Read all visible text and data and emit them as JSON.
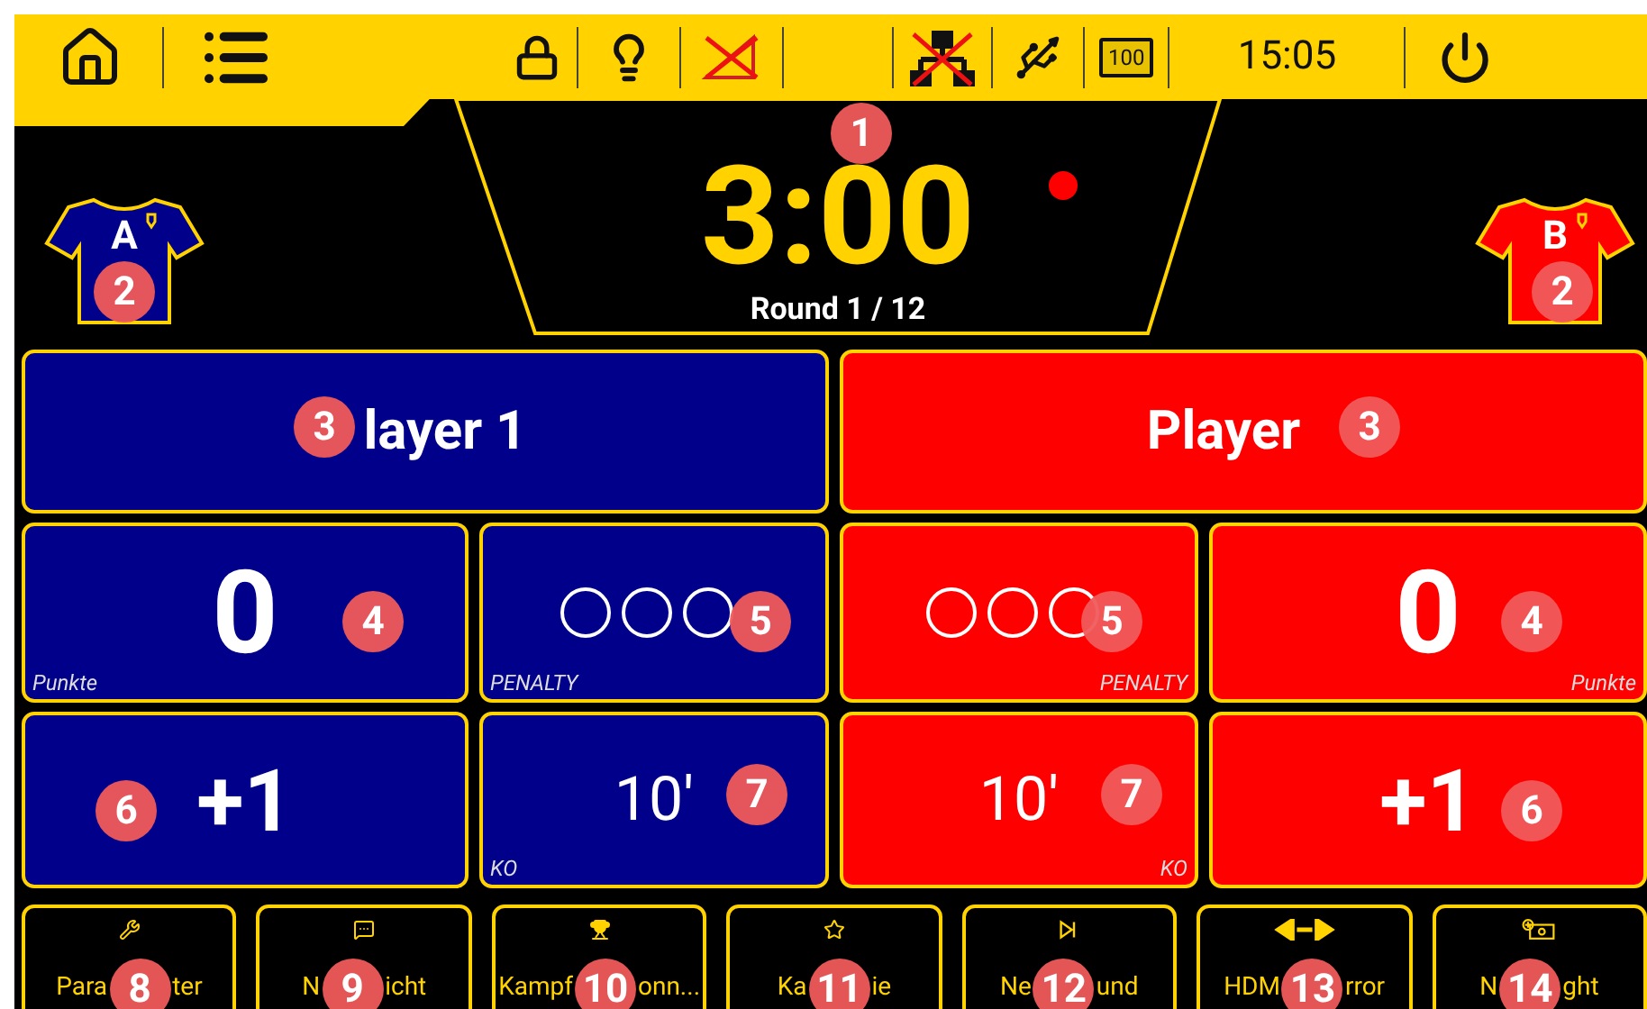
{
  "top_bar": {
    "time": "15:05",
    "battery": "100"
  },
  "timer": {
    "time": "3:00",
    "round": "Round 1 / 12",
    "running": true,
    "marker": "1"
  },
  "teams": [
    {
      "color": "#00008b",
      "letter": "A",
      "shirt_marker": "2",
      "name": "layer 1",
      "name_marker": "3",
      "score": "0",
      "score_label": "Punkte",
      "score_marker": "4",
      "penalties": [
        {
          "filled": false
        },
        {
          "filled": false
        },
        {
          "filled": false
        }
      ],
      "penalty_label": "PENALTY",
      "penalty_marker": "5",
      "add": "+1",
      "add_marker": "6",
      "ko": "10'",
      "ko_label": "KO",
      "ko_marker": "7"
    },
    {
      "color": "#ff0000",
      "letter": "B",
      "shirt_marker": "2",
      "name": "Player",
      "name_marker": "3",
      "score": "0",
      "score_label": "Punkte",
      "score_marker": "4",
      "penalties": [
        {
          "filled": false
        },
        {
          "filled": false
        },
        {
          "filled": false
        }
      ],
      "penalty_label": "PENALTY",
      "penalty_marker": "5",
      "add": "+1",
      "add_marker": "6",
      "ko": "10'",
      "ko_label": "KO",
      "ko_marker": "7"
    }
  ],
  "buttons": [
    {
      "kind": "wrench",
      "before": "Para",
      "after": "ter",
      "marker": "8"
    },
    {
      "kind": "message",
      "before": "N",
      "after": "icht",
      "marker": "9"
    },
    {
      "kind": "trophy",
      "before": "Kampf",
      "after": "onn...",
      "marker": "10"
    },
    {
      "kind": "star",
      "before": "Ka",
      "after": "ie",
      "marker": "11"
    },
    {
      "kind": "next",
      "before": "Ne",
      "after": "und",
      "marker": "12"
    },
    {
      "kind": "mirror",
      "before": "HDM",
      "after": "rror",
      "marker": "13"
    },
    {
      "kind": "field",
      "before": "N",
      "after": "ght",
      "marker": "14"
    }
  ]
}
